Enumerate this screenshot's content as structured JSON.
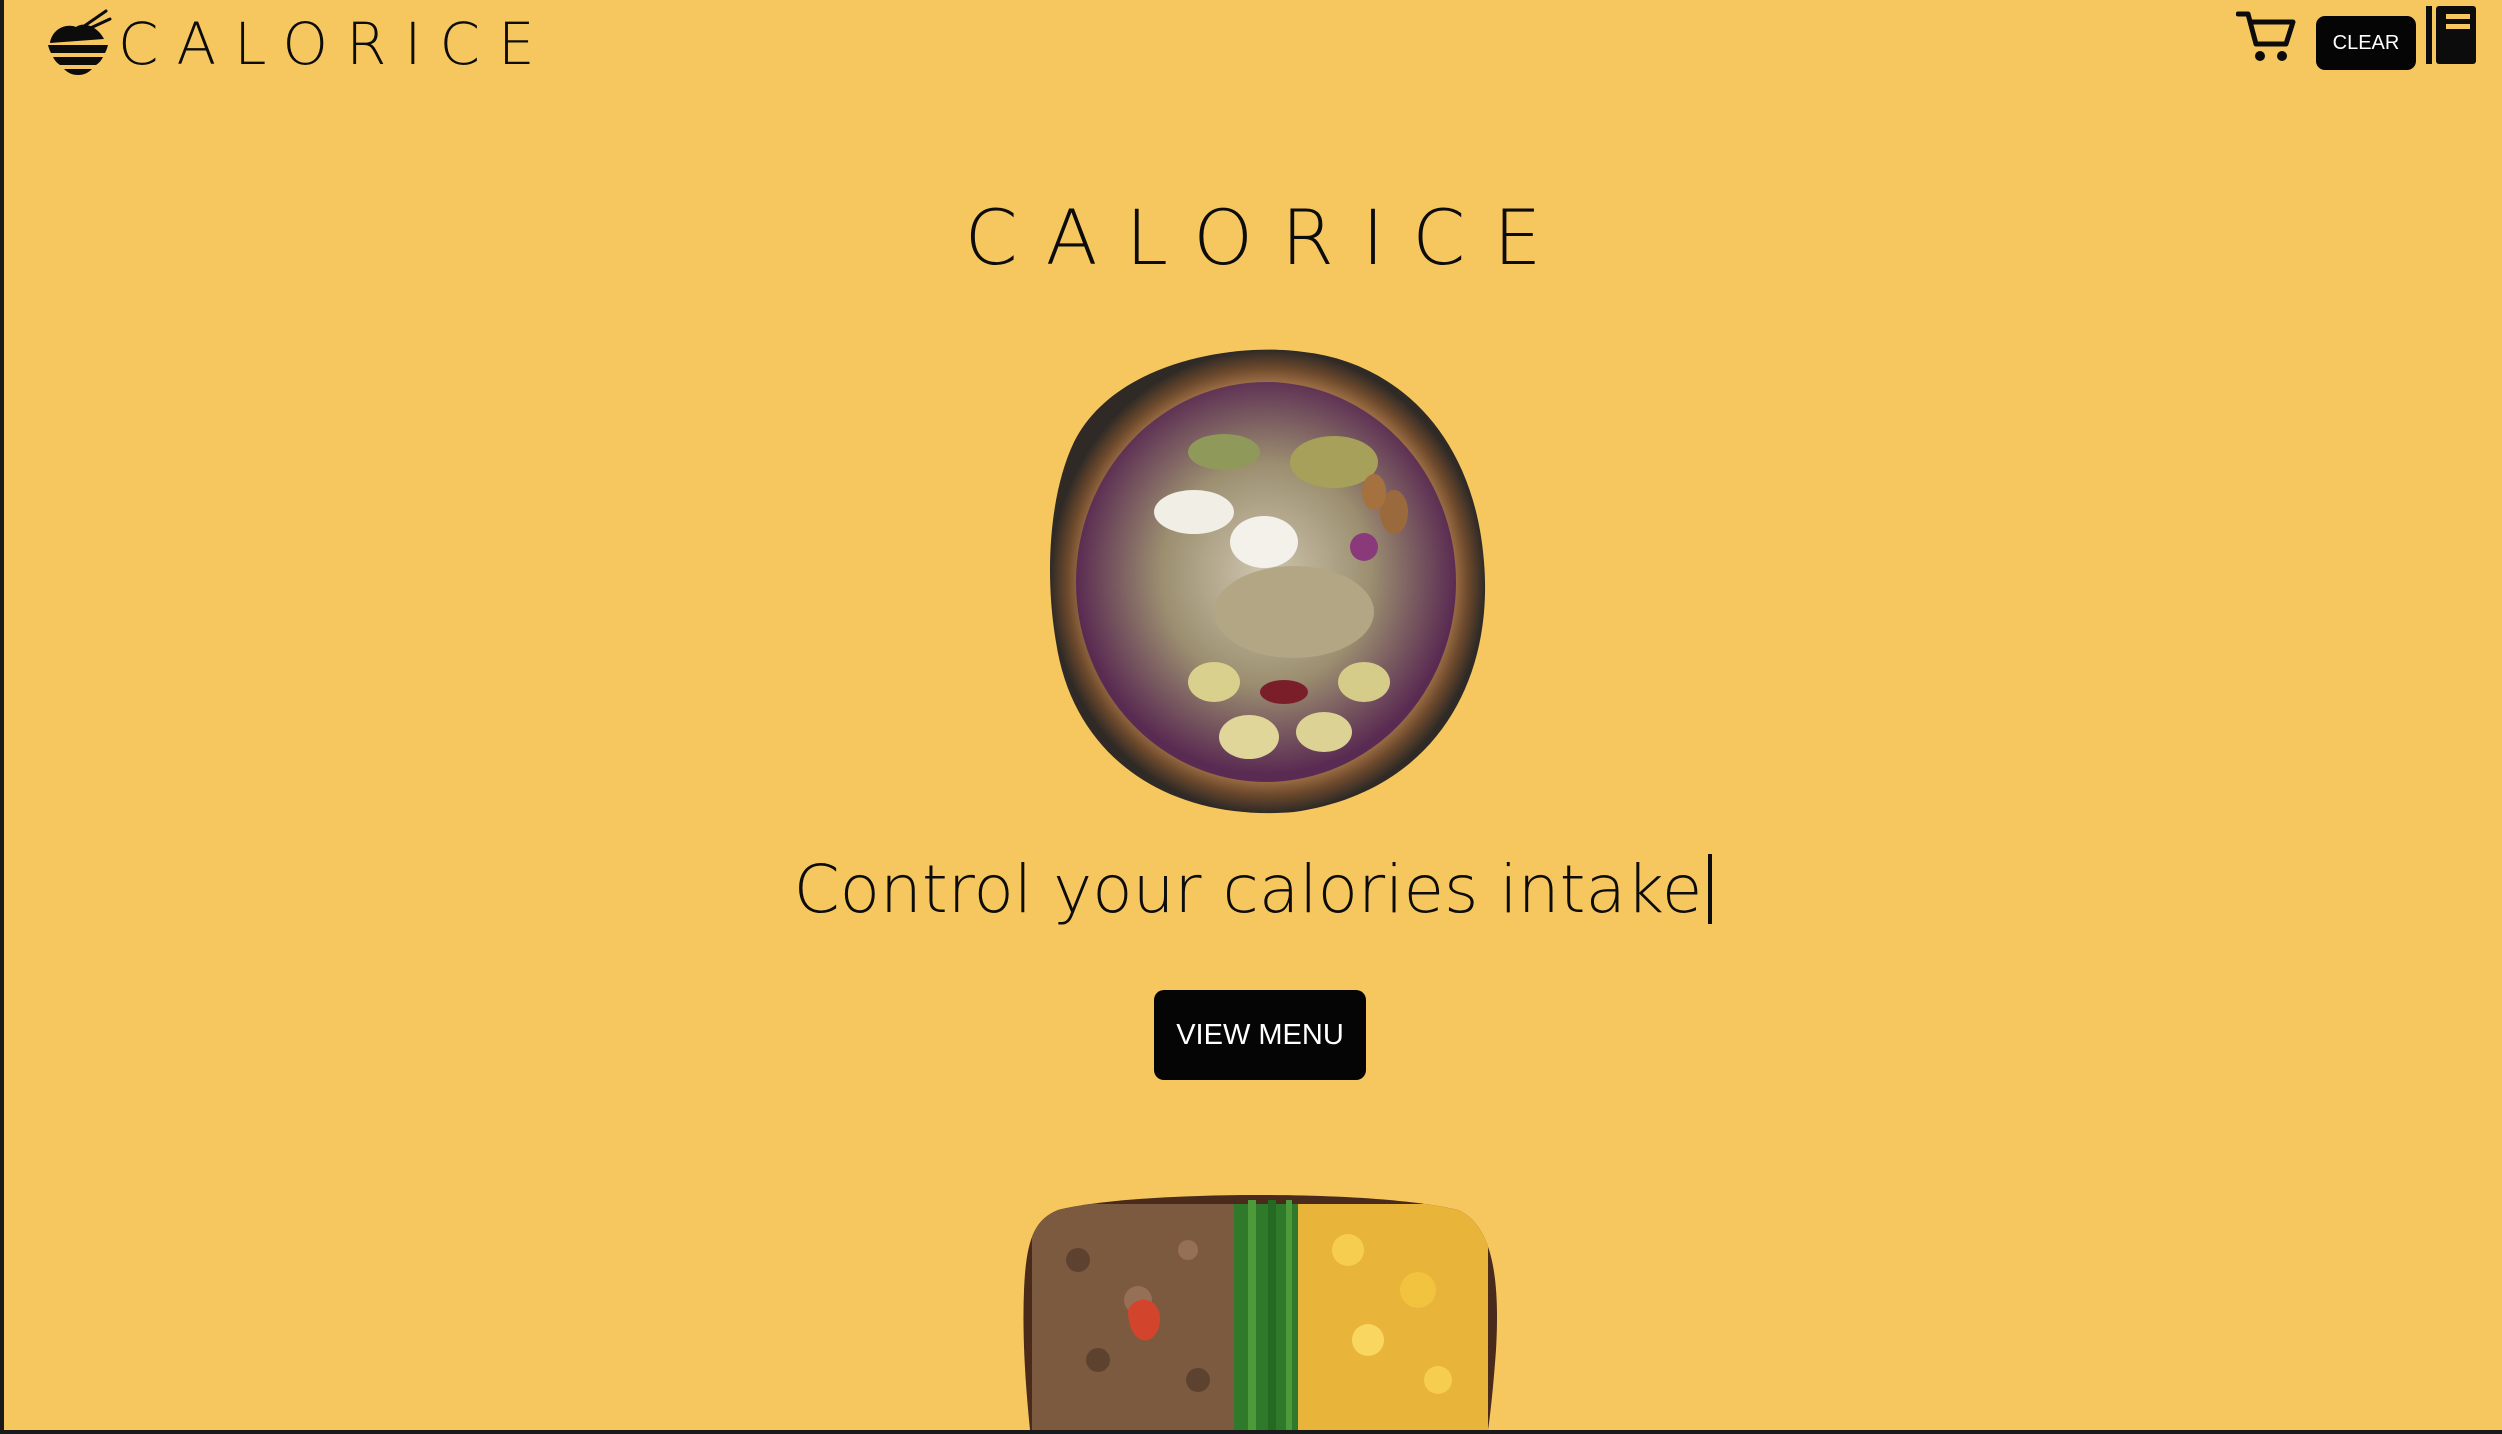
{
  "header": {
    "brand_name": "CALORICE",
    "logo_icon": "rice-bowl-chopsticks-logo",
    "cart_icon": "shopping-cart-icon",
    "clear_label": "CLEAR",
    "menu_icon": "book-icon"
  },
  "hero": {
    "title": "CALORICE",
    "tagline": "Control your calories intake",
    "view_menu_label": "VIEW MENU",
    "images": [
      {
        "name": "smoothie-bowl-image",
        "description_icon": "food-bowl-photo"
      },
      {
        "name": "bento-box-image",
        "description_icon": "bento-box-photo"
      }
    ]
  },
  "colors": {
    "background": "#F6C75F",
    "text": "#0c0c0c",
    "button_bg": "#050505",
    "button_text": "#ffffff"
  }
}
